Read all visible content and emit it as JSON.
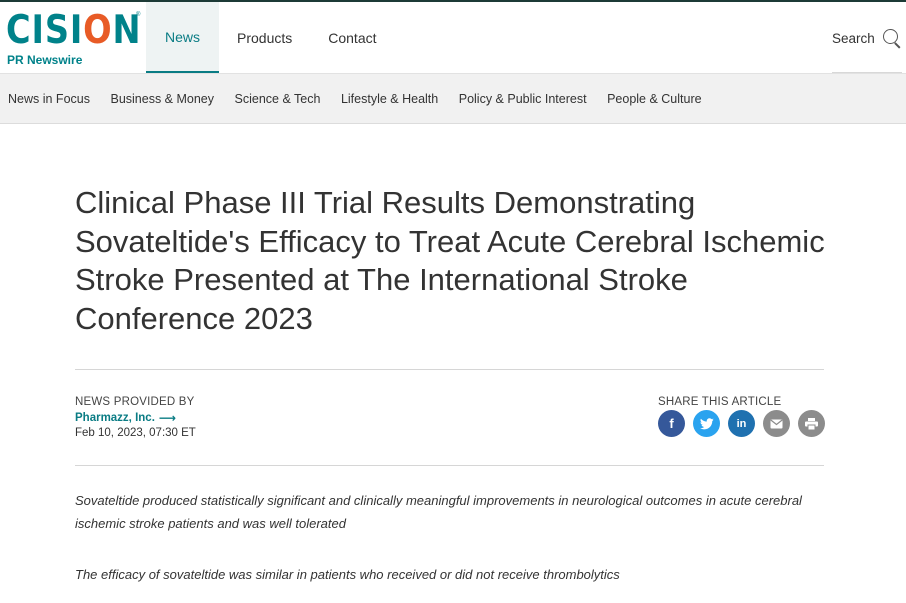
{
  "brand": {
    "wordmark_start": "CISI",
    "wordmark_o": "O",
    "wordmark_end": "N",
    "registered": "®",
    "subtitle": "PR Newswire"
  },
  "main_nav": [
    {
      "label": "News",
      "active": true
    },
    {
      "label": "Products",
      "active": false
    },
    {
      "label": "Contact",
      "active": false
    }
  ],
  "search": {
    "label": "Search",
    "icon": "magnifier-icon"
  },
  "sub_nav": [
    "News in Focus",
    "Business & Money",
    "Science & Tech",
    "Lifestyle & Health",
    "Policy & Public Interest",
    "People & Culture"
  ],
  "article": {
    "headline": "Clinical Phase III Trial Results Demonstrating Sovateltide's Efficacy to Treat Acute Cerebral Ischemic Stroke Presented at The International Stroke Conference 2023",
    "provided_by_label": "NEWS PROVIDED BY",
    "provider": "Pharmazz, Inc.",
    "provider_arrow": "⟶",
    "date": "Feb 10, 2023, 07:30 ET",
    "share_label": "SHARE THIS ARTICLE",
    "share_icons": [
      {
        "name": "facebook-icon",
        "glyph": "f"
      },
      {
        "name": "twitter-icon",
        "glyph": ""
      },
      {
        "name": "linkedin-icon",
        "glyph": "in"
      },
      {
        "name": "email-icon",
        "glyph": ""
      },
      {
        "name": "print-icon",
        "glyph": ""
      }
    ],
    "summary": [
      "Sovateltide produced statistically significant and clinically meaningful improvements in neurological outcomes in acute cerebral ischemic stroke patients and was well tolerated",
      "The efficacy of sovateltide was similar in patients who received or did not receive thrombolytics"
    ]
  },
  "colors": {
    "brand_teal": "#00828a",
    "brand_orange": "#e85b26",
    "facebook": "#35589a",
    "twitter": "#2aa3ef",
    "linkedin": "#1f71b0",
    "grey_icon": "#8c8c8c"
  }
}
